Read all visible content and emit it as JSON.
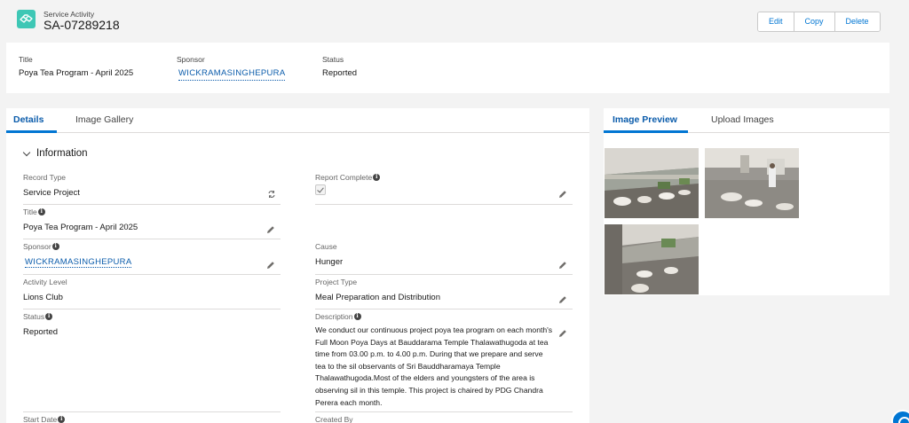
{
  "header": {
    "object_type": "Service Activity",
    "record_name": "SA-07289218",
    "actions": [
      "Edit",
      "Copy",
      "Delete"
    ]
  },
  "highlights": {
    "title_label": "Title",
    "title_value": "Poya Tea Program - April 2025",
    "sponsor_label": "Sponsor",
    "sponsor_value": "WICKRAMASINGHEPURA",
    "status_label": "Status",
    "status_value": "Reported"
  },
  "left_tabs": [
    "Details",
    "Image Gallery"
  ],
  "section": {
    "title": "Information"
  },
  "fields": {
    "record_type": {
      "label": "Record Type",
      "value": "Service Project"
    },
    "report_complete": {
      "label": "Report Complete",
      "checked": true
    },
    "title": {
      "label": "Title",
      "value": "Poya Tea Program - April 2025"
    },
    "sponsor": {
      "label": "Sponsor",
      "value": "WICKRAMASINGHEPURA"
    },
    "cause": {
      "label": "Cause",
      "value": "Hunger"
    },
    "activity_level": {
      "label": "Activity Level",
      "value": "Lions Club"
    },
    "project_type": {
      "label": "Project Type",
      "value": "Meal Preparation and Distribution"
    },
    "status": {
      "label": "Status",
      "value": "Reported"
    },
    "description": {
      "label": "Description",
      "value": "We conduct our continuous project poya tea program on each month's Full Moon Poya Days at Bauddarama Temple Thalawathugoda at tea time from 03.00 p.m. to 4.00 p.m. During that we prepare and serve tea to the sil observants of Sri Bauddharamaya Temple Thalawathugoda.Most of the elders and youngsters of the area is observing sil in this temple. This project is chaired by PDG Chandra Perera each month."
    },
    "start_date": {
      "label": "Start Date"
    },
    "created_by": {
      "label": "Created By"
    }
  },
  "right_tabs": [
    "Image Preview",
    "Upload Images"
  ],
  "colors": {
    "brand": "#0176d3",
    "link": "#0b5cab",
    "object_icon": "#3ec7b5"
  },
  "icons": [
    "service-activity-icon",
    "chevron-down-icon",
    "info-icon",
    "pencil-icon",
    "change-record-type-icon",
    "checkbox-icon",
    "help-icon"
  ]
}
